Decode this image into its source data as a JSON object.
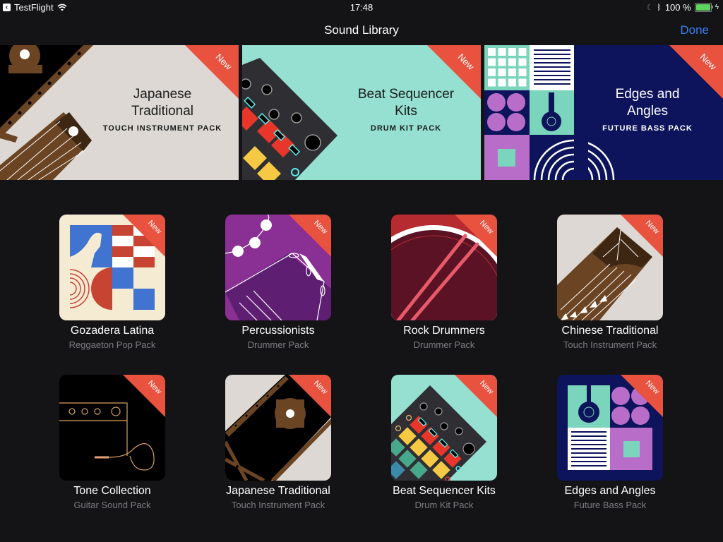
{
  "status_bar": {
    "back_app": "TestFlight",
    "time": "17:48",
    "battery": "100 %",
    "battery_level": 1.0,
    "icons": [
      "back-arrow-icon",
      "wifi-icon",
      "moon-icon",
      "bluetooth-icon",
      "battery-icon",
      "charging-icon"
    ]
  },
  "nav": {
    "title": "Sound Library",
    "done_label": "Done"
  },
  "badge_label": "New",
  "colors": {
    "accent": "#3a7ff0",
    "ribbon": "#e8523f",
    "background": "#141416"
  },
  "featured": [
    {
      "title_line1": "Japanese",
      "title_line2": "Traditional",
      "subtitle": "TOUCH INSTRUMENT PACK",
      "badge": "New",
      "bg": "#ddd8d3"
    },
    {
      "title_line1": "Beat Sequencer",
      "title_line2": "Kits",
      "subtitle": "DRUM KIT PACK",
      "badge": "New",
      "bg": "#95e0d0"
    },
    {
      "title_line1": "Edges and",
      "title_line2": "Angles",
      "subtitle": "FUTURE BASS PACK",
      "badge": "New",
      "bg": "#0d145c"
    }
  ],
  "packs": [
    {
      "name": "Gozadera Latina",
      "type": "Reggaeton Pop Pack",
      "badge": "New"
    },
    {
      "name": "Percussionists",
      "type": "Drummer Pack",
      "badge": "New"
    },
    {
      "name": "Rock Drummers",
      "type": "Drummer Pack",
      "badge": "New"
    },
    {
      "name": "Chinese Traditional",
      "type": "Touch Instrument Pack",
      "badge": "New"
    },
    {
      "name": "Tone Collection",
      "type": "Guitar Sound Pack",
      "badge": "New"
    },
    {
      "name": "Japanese Traditional",
      "type": "Touch Instrument Pack",
      "badge": "New"
    },
    {
      "name": "Beat Sequencer Kits",
      "type": "Drum Kit Pack",
      "badge": "New"
    },
    {
      "name": "Edges and Angles",
      "type": "Future Bass Pack",
      "badge": "New"
    }
  ]
}
